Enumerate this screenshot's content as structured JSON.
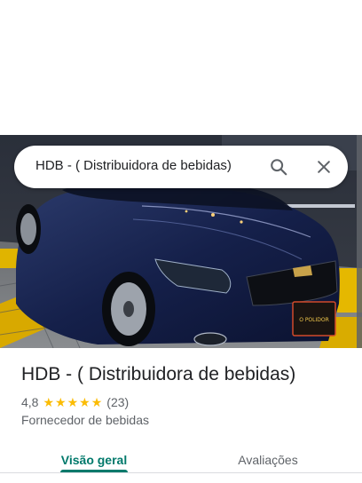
{
  "search": {
    "query": "HDB - ( Distribuidora de bebidas)"
  },
  "place": {
    "title": "HDB - ( Distribuidora de bebidas)",
    "rating": "4,8",
    "stars": 5,
    "review_count": "(23)",
    "category": "Fornecedor de bebidas",
    "photo_sign_text": "O POLIDOR"
  },
  "tabs": [
    {
      "label": "Visão geral",
      "active": true
    },
    {
      "label": "Avaliações",
      "active": false
    }
  ],
  "colors": {
    "accent": "#00796b",
    "star": "#fbbc04",
    "secondary_text": "#5f6368"
  }
}
